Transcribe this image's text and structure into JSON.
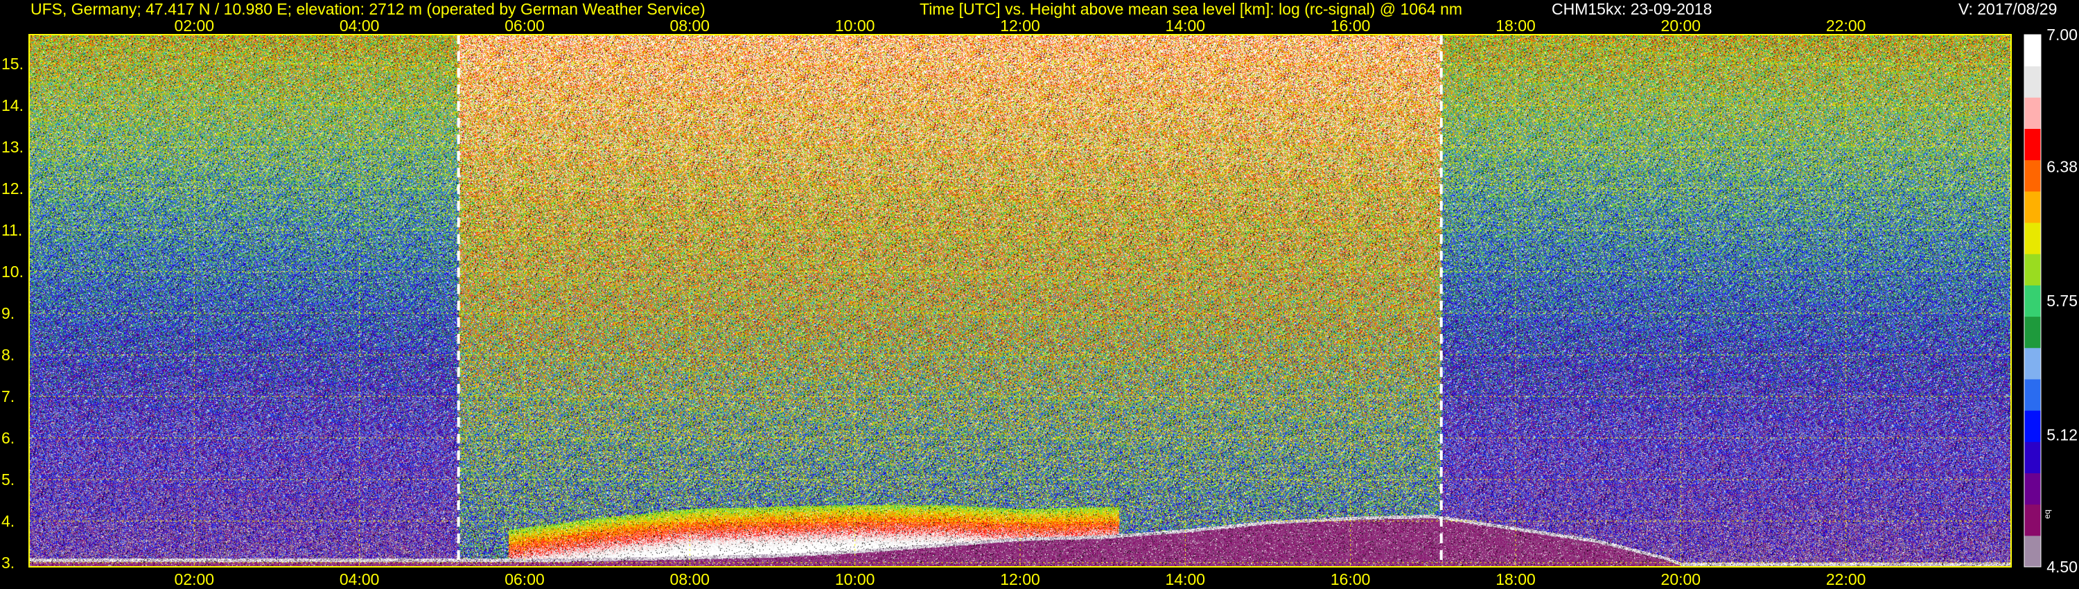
{
  "header": {
    "station": "UFS, Germany; 47.417 N / 10.980 E; elevation: 2712 m  (operated by German Weather Service)",
    "title": "Time [UTC] vs. Height above mean sea level [km]: log (rc-signal) @ 1064 nm",
    "instrument": "CHM15kx: 23-09-2018",
    "version": "V: 2017/08/29"
  },
  "colors": {
    "header_text": "#ffff00",
    "title_text": "#ffff00",
    "info_text": "#ffffff",
    "grid": "#ffff00",
    "background": "#000000",
    "sunrise_sunset_line": "#ffffff",
    "colorbar": [
      "#a08aa6",
      "#8a0a6a",
      "#6a0090",
      "#2a00c8",
      "#0010ff",
      "#2a6cf0",
      "#80b0f0",
      "#1e9a3c",
      "#36d070",
      "#9adc20",
      "#e8e800",
      "#ffb000",
      "#ff6600",
      "#ff0000",
      "#ffb0b0",
      "#e6e6e6",
      "#ffffff"
    ]
  },
  "chart_data": {
    "type": "heatmap",
    "title": "Time [UTC] vs. Height above mean sea level [km]: log (rc-signal) @ 1064 nm",
    "xlabel": "Time [UTC]",
    "ylabel": "Height above mean sea level [km]",
    "xlim": [
      0,
      24
    ],
    "ylim": [
      2.9,
      15.7
    ],
    "x_ticks": [
      2,
      4,
      6,
      8,
      10,
      12,
      14,
      16,
      18,
      20,
      22
    ],
    "x_tick_labels": [
      "02:00",
      "04:00",
      "06:00",
      "08:00",
      "10:00",
      "12:00",
      "14:00",
      "16:00",
      "18:00",
      "20:00",
      "22:00"
    ],
    "y_ticks": [
      3,
      4,
      5,
      6,
      7,
      8,
      9,
      10,
      11,
      12,
      13,
      14,
      15
    ],
    "y_tick_labels": [
      "3.",
      "4.",
      "5.",
      "6.",
      "7.",
      "8.",
      "9.",
      "10.",
      "11.",
      "12.",
      "13.",
      "14.",
      "15."
    ],
    "grid": true,
    "colorbar": {
      "min": 4.5,
      "max": 7.0,
      "labels": [
        4.5,
        5.12,
        5.75,
        6.38,
        7.0
      ],
      "tick_label_text": [
        "4.50",
        "5.12",
        "5.75",
        "6.38",
        "7.00"
      ],
      "unit_marks": [
        "eq"
      ]
    },
    "vertical_markers": [
      {
        "time": 5.2
      },
      {
        "time": 17.1
      }
    ],
    "cloud_layer_top_km": [
      {
        "t": 0.0,
        "h": 3.05
      },
      {
        "t": 5.2,
        "h": 3.05
      },
      {
        "t": 6.5,
        "h": 3.05
      },
      {
        "t": 8.0,
        "h": 3.1
      },
      {
        "t": 9.0,
        "h": 3.15
      },
      {
        "t": 10.0,
        "h": 3.25
      },
      {
        "t": 11.0,
        "h": 3.4
      },
      {
        "t": 12.0,
        "h": 3.55
      },
      {
        "t": 13.0,
        "h": 3.6
      },
      {
        "t": 14.0,
        "h": 3.75
      },
      {
        "t": 15.0,
        "h": 3.95
      },
      {
        "t": 16.0,
        "h": 4.05
      },
      {
        "t": 17.0,
        "h": 4.1
      },
      {
        "t": 18.0,
        "h": 3.8
      },
      {
        "t": 19.0,
        "h": 3.5
      },
      {
        "t": 19.8,
        "h": 3.1
      },
      {
        "t": 20.0,
        "h": 2.95
      },
      {
        "t": 24.0,
        "h": 2.95
      }
    ],
    "aerosol_layer_top_km": [
      {
        "t": 5.8,
        "h": 3.8
      },
      {
        "t": 7.0,
        "h": 4.1
      },
      {
        "t": 8.0,
        "h": 4.3
      },
      {
        "t": 9.0,
        "h": 4.35
      },
      {
        "t": 10.0,
        "h": 4.4
      },
      {
        "t": 11.0,
        "h": 4.4
      },
      {
        "t": 12.0,
        "h": 4.3
      },
      {
        "t": 13.0,
        "h": 4.35
      }
    ]
  }
}
